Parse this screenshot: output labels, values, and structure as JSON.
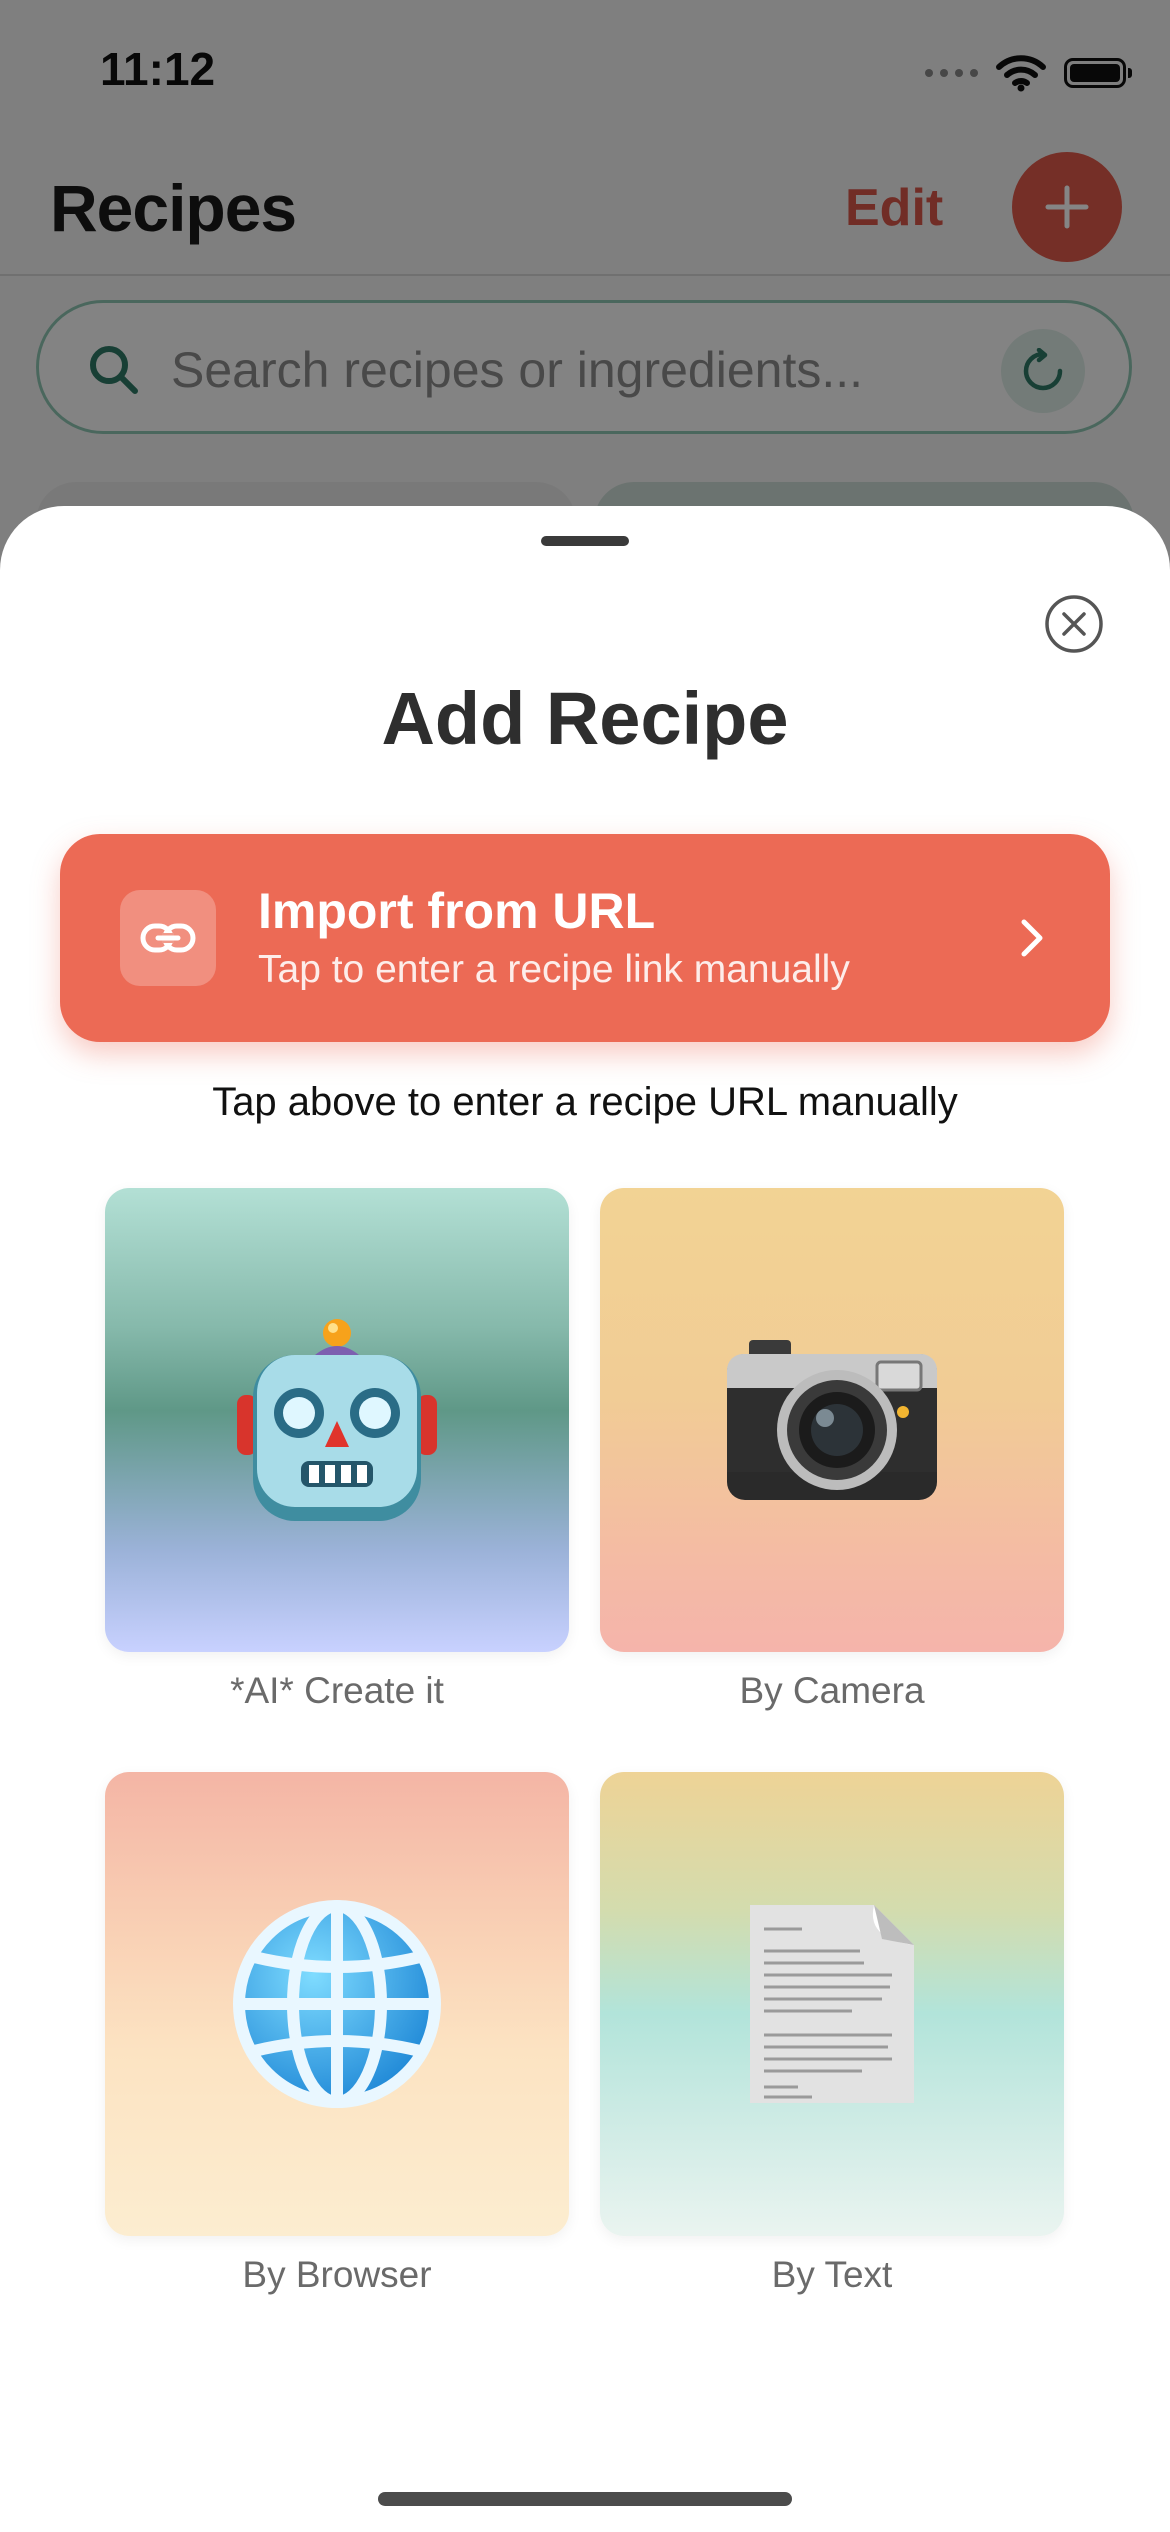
{
  "status_bar": {
    "time": "11:12"
  },
  "nav": {
    "title": "Recipes",
    "edit_label": "Edit",
    "add_icon": "plus-icon"
  },
  "search": {
    "placeholder": "Search recipes or ingredients...",
    "value": ""
  },
  "sheet": {
    "title": "Add Recipe",
    "import_url": {
      "title": "Import from URL",
      "subtitle": "Tap to enter a recipe link manually"
    },
    "helper_text": "Tap above to enter a recipe URL manually",
    "options": [
      {
        "label": "*AI* Create it",
        "icon": "robot-icon"
      },
      {
        "label": "By Camera",
        "icon": "camera-icon"
      },
      {
        "label": "By Browser",
        "icon": "globe-icon"
      },
      {
        "label": "By Text",
        "icon": "document-icon"
      }
    ]
  },
  "colors": {
    "accent": "#EC6A55",
    "accent_dark": "#E15B4C",
    "teal": "#2F7A66"
  }
}
